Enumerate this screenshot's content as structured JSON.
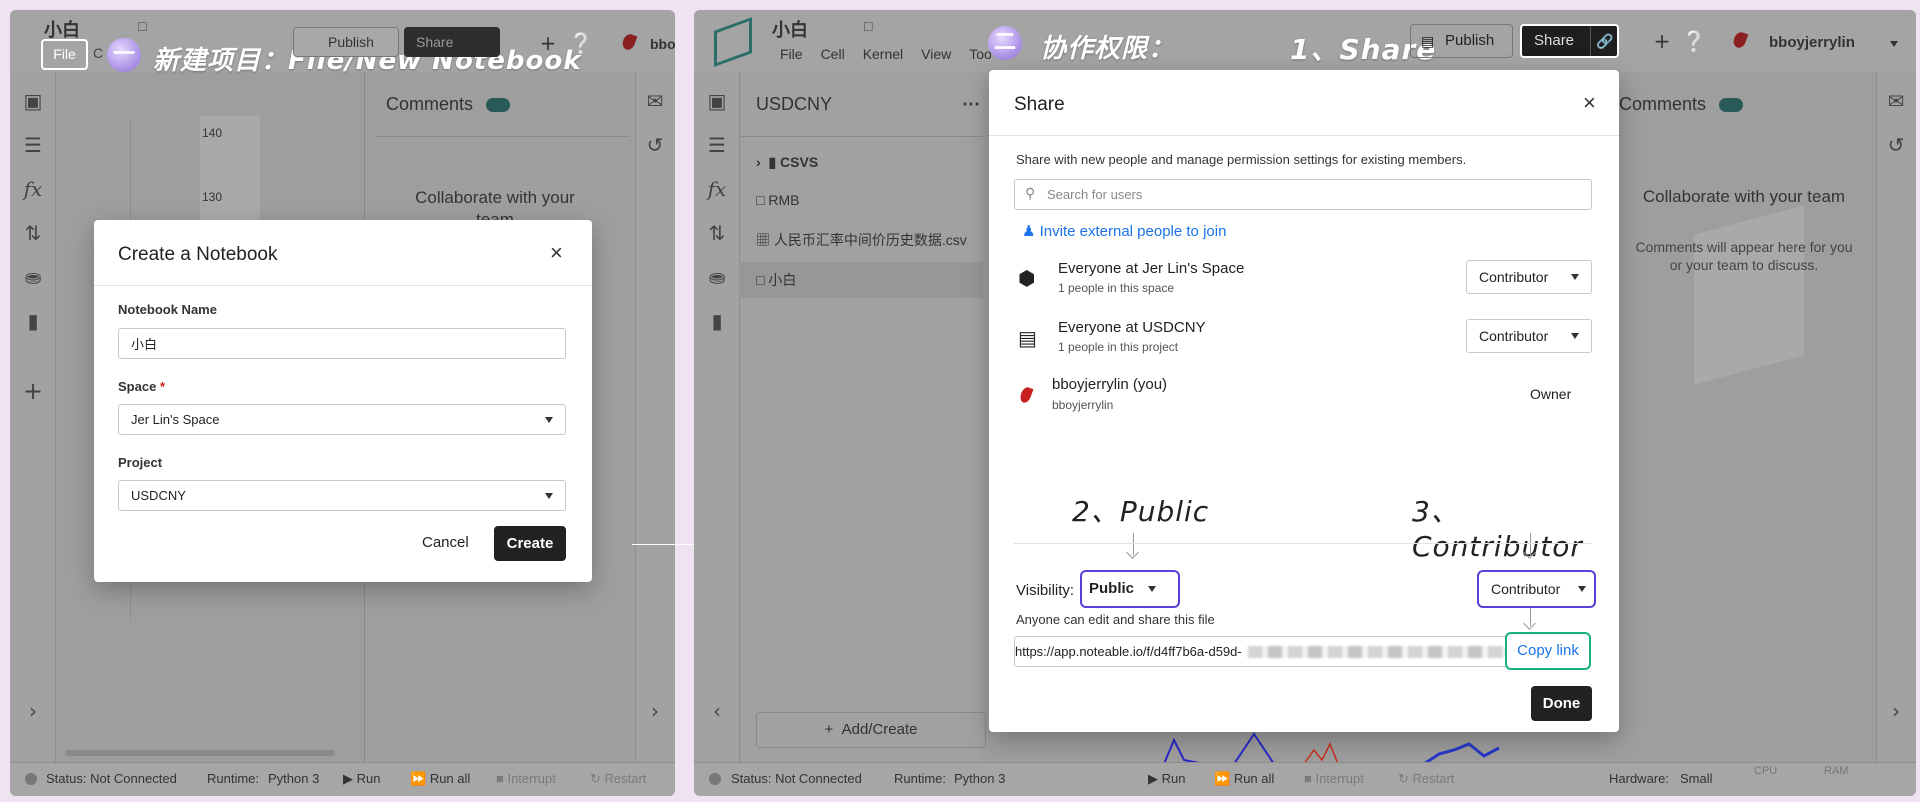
{
  "left": {
    "title": "小白",
    "menu_file": "File",
    "menu_other": "C",
    "annotation_num": "一",
    "annotation": "新建项目：File/New Notebook",
    "publish_label": "Publish",
    "share_label": "Share",
    "user_partial": "bbo",
    "comments_title": "Comments",
    "comments_collab": "Collaborate with your",
    "comments_team": "team",
    "axis_ticks": [
      "140",
      "130"
    ],
    "modal": {
      "title": "Create a Notebook",
      "name_label": "Notebook Name",
      "name_value": "小白",
      "space_label": "Space",
      "required_mark": "*",
      "space_value": "Jer Lin's Space",
      "project_label": "Project",
      "project_value": "USDCNY",
      "cancel_label": "Cancel",
      "create_label": "Create",
      "close_symbol": "×"
    },
    "status": {
      "status_text": "Status: Not Connected",
      "runtime_label": "Runtime:",
      "runtime_value": "Python 3",
      "run": "Run",
      "run_all": "Run all",
      "interrupt": "Interrupt",
      "restart": "Restart"
    }
  },
  "right": {
    "title": "小白",
    "menus": [
      "File",
      "Cell",
      "Kernel",
      "View",
      "Tools"
    ],
    "annotation_num": "二",
    "annotation": "协作权限：",
    "annotation_share": "1、Share",
    "publish_label": "Publish",
    "share_label": "Share",
    "user_name": "bboyjerrylin",
    "sidebar_title": "USDCNY",
    "files": [
      {
        "name": "CSVS",
        "type": "folder"
      },
      {
        "name": "RMB",
        "type": "notebook"
      },
      {
        "name": "人民币汇率中间价历史数据.csv",
        "type": "csv"
      },
      {
        "name": "小白",
        "type": "notebook"
      }
    ],
    "add_create": "Add/Create",
    "comments_title": "Comments",
    "comments_collab": "Collaborate with your team",
    "comments_desc": "Comments will appear here for you or your team to discuss.",
    "share_modal": {
      "title": "Share",
      "close_symbol": "×",
      "description": "Share with new people and manage permission settings for existing members.",
      "search_placeholder": "Search for users",
      "invite_label": "Invite external people to join",
      "members": [
        {
          "name": "Everyone at Jer Lin's Space",
          "sub": "1 people in this space",
          "role": "Contributor"
        },
        {
          "name": "Everyone at USDCNY",
          "sub": "1 people in this project",
          "role": "Contributor"
        },
        {
          "name": "bboyjerrylin (you)",
          "sub": "bboyjerrylin",
          "role": "Owner"
        }
      ],
      "annotation_public": "2、Public",
      "annotation_contributor": "3、Contributor",
      "visibility_label": "Visibility:",
      "visibility_value": "Public",
      "visibility_role": "Contributor",
      "visibility_note": "Anyone can edit and share this file",
      "link_value": "https://app.noteable.io/f/d4ff7b6a-d59d-",
      "copy_link": "Copy link",
      "done": "Done"
    },
    "status": {
      "status_text": "Status: Not Connected",
      "runtime_label": "Runtime:",
      "runtime_value": "Python 3",
      "run": "Run",
      "run_all": "Run all",
      "interrupt": "Interrupt",
      "restart": "Restart",
      "hardware_label": "Hardware:",
      "hardware_value": "Small",
      "cpu": "CPU",
      "ram": "RAM"
    }
  },
  "colors": {
    "accent_purple": "#5b3fd6",
    "accent_green": "#16b07a",
    "link_blue": "#1a73e8",
    "dark_btn": "#222222"
  }
}
